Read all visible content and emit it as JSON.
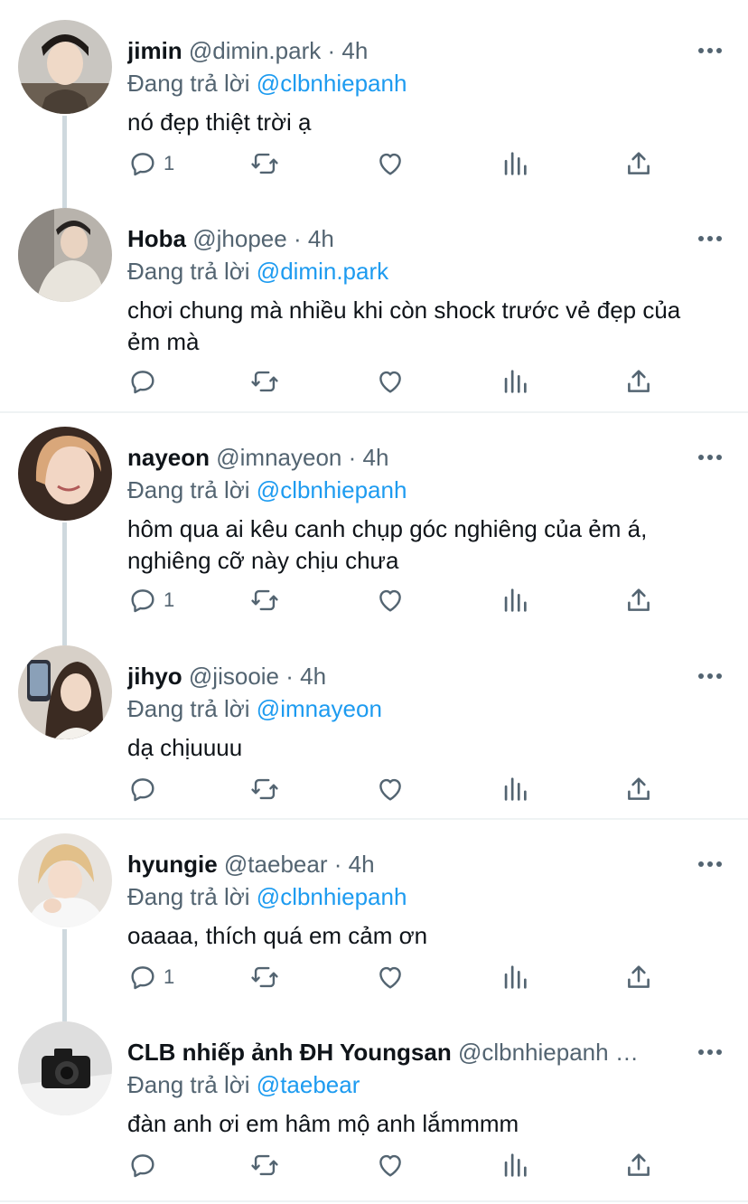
{
  "ui": {
    "replying_to": "Đang trả lời",
    "accent": "#1d9bf0",
    "text_color": "#0f1419",
    "muted_color": "#536471"
  },
  "tweets": [
    {
      "name": "jimin",
      "handle": "@dimin.park",
      "dot": "·",
      "time": "4h",
      "replying_to_handle": "@clbnhiepanh",
      "text": "nó đẹp thiệt trời ạ",
      "reply_count": "1"
    },
    {
      "name": "Hoba",
      "handle": "@jhopee",
      "dot": "·",
      "time": "4h",
      "replying_to_handle": "@dimin.park",
      "text": "chơi chung mà nhiều khi còn shock trước vẻ đẹp của ẻm mà",
      "reply_count": ""
    },
    {
      "name": "nayeon",
      "handle": "@imnayeon",
      "dot": "·",
      "time": "4h",
      "replying_to_handle": "@clbnhiepanh",
      "text": "hôm qua ai kêu canh chụp góc nghiêng của ẻm á, nghiêng cỡ này chịu chưa",
      "reply_count": "1"
    },
    {
      "name": "jihyo",
      "handle": "@jisooie",
      "dot": "·",
      "time": "4h",
      "replying_to_handle": "@imnayeon",
      "text": "dạ chịuuuu",
      "reply_count": ""
    },
    {
      "name": "hyungie",
      "handle": "@taebear",
      "dot": "·",
      "time": "4h",
      "replying_to_handle": "@clbnhiepanh",
      "text": "oaaaa, thích quá em cảm ơn",
      "reply_count": "1"
    },
    {
      "name": "CLB nhiếp ảnh ĐH Youngsan",
      "handle": "@clbnhiepanh",
      "dot": "…",
      "time": "",
      "replying_to_handle": "@taebear",
      "text": "đàn anh ơi em hâm mộ anh lắmmmm",
      "reply_count": ""
    }
  ],
  "icons": {
    "reply": "reply-icon",
    "retweet": "retweet-icon",
    "like": "heart-icon",
    "views": "views-icon",
    "share": "share-icon",
    "more": "more-icon"
  }
}
